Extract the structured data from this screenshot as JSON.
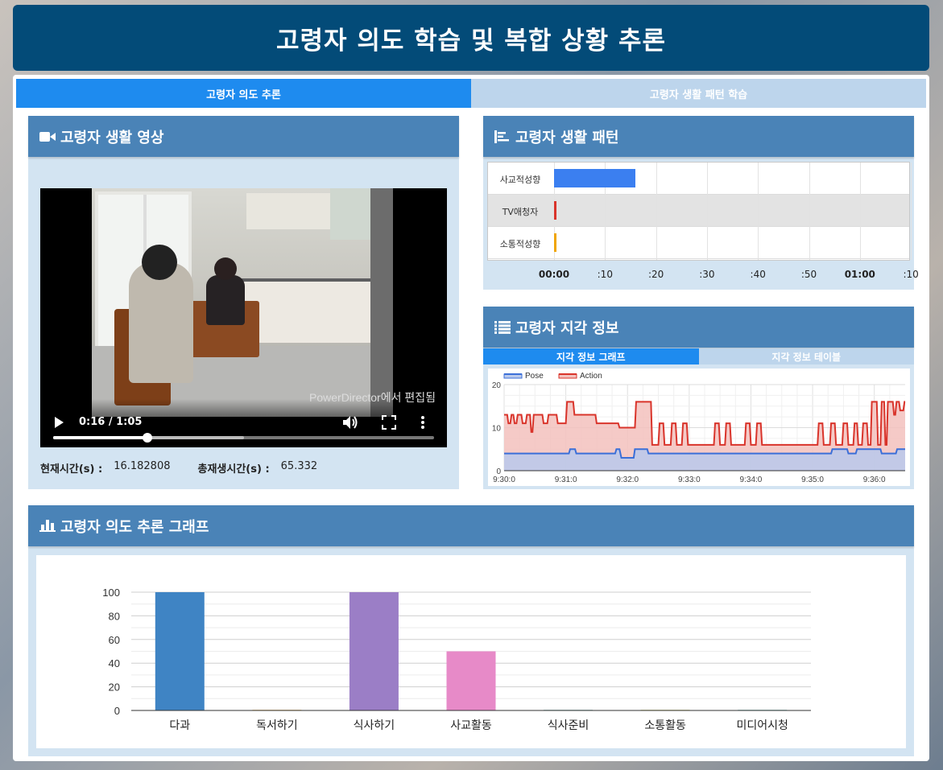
{
  "header": {
    "title": "고령자 의도 학습 및 복합 상황 추론"
  },
  "tabs": [
    {
      "label": "고령자 의도 추론",
      "active": true
    },
    {
      "label": "고령자 생활 패턴 학습",
      "active": false
    }
  ],
  "video_panel": {
    "title": "고령자 생활 영상",
    "icon": "video-camera-icon",
    "player": {
      "time_display": "0:16 / 1:05",
      "watermark": "PowerDirector에서 편집됨",
      "progress_fraction": 0.248,
      "buffered_fraction": 0.5
    },
    "current_time_label": "현재시간(s) :",
    "current_time_value": "16.182808",
    "total_time_label": "총재생시간(s) :",
    "total_time_value": "65.332"
  },
  "pattern_panel": {
    "title": "고령자 생활 패턴",
    "icon": "timeline-icon",
    "rows": [
      {
        "label": "사교적성향",
        "start": 0,
        "end": 16,
        "color": "#3b7ff0"
      },
      {
        "label": "TV애청자",
        "start": 0,
        "end": 0.4,
        "color": "#d9342b"
      },
      {
        "label": "소통적성향",
        "start": 0,
        "end": 0.4,
        "color": "#f0a500"
      }
    ],
    "axis_ticks": [
      {
        "label": "00:00",
        "value": 0,
        "bold": true
      },
      {
        "label": ":10",
        "value": 10,
        "bold": false
      },
      {
        "label": ":20",
        "value": 20,
        "bold": false
      },
      {
        "label": ":30",
        "value": 30,
        "bold": false
      },
      {
        "label": ":40",
        "value": 40,
        "bold": false
      },
      {
        "label": ":50",
        "value": 50,
        "bold": false
      },
      {
        "label": "01:00",
        "value": 60,
        "bold": true
      },
      {
        "label": ":10",
        "value": 70,
        "bold": false
      }
    ]
  },
  "perception_panel": {
    "title": "고령자 지각 정보",
    "icon": "list-icon",
    "subtabs": [
      {
        "label": "지각 정보 그래프",
        "active": true
      },
      {
        "label": "지각 정보 테이블",
        "active": false
      }
    ]
  },
  "intent_panel": {
    "title": "고령자 의도 추론 그래프",
    "icon": "bar-chart-icon"
  },
  "chart_data": [
    {
      "type": "area",
      "x_labels": [
        "9:30:0",
        "9:31:0",
        "9:32:0",
        "9:33:0",
        "9:34:0",
        "9:35:0",
        "9:36:0"
      ],
      "x_range_minutes": [
        0,
        6.5
      ],
      "ylim": [
        0,
        20
      ],
      "y_ticks": [
        0,
        10,
        20
      ],
      "legend_position": "top-left",
      "series": [
        {
          "name": "Pose",
          "color": "#3b6fd8",
          "fill": "#b9c9ec",
          "points": [
            [
              0,
              4
            ],
            [
              1.05,
              4
            ],
            [
              1.07,
              5
            ],
            [
              1.15,
              5
            ],
            [
              1.17,
              4
            ],
            [
              1.8,
              4
            ],
            [
              1.82,
              5
            ],
            [
              1.87,
              5
            ],
            [
              1.9,
              3
            ],
            [
              2.1,
              3
            ],
            [
              2.12,
              5
            ],
            [
              2.32,
              5
            ],
            [
              2.34,
              4
            ],
            [
              5.3,
              4
            ],
            [
              5.32,
              5
            ],
            [
              5.56,
              5
            ],
            [
              5.58,
              4
            ],
            [
              5.7,
              4
            ],
            [
              5.72,
              5
            ],
            [
              6.1,
              5
            ],
            [
              6.12,
              4
            ],
            [
              6.35,
              4
            ],
            [
              6.37,
              5
            ],
            [
              6.5,
              5
            ]
          ]
        },
        {
          "name": "Action",
          "color": "#d9342b",
          "fill": "#f3c1bd",
          "points": [
            [
              0,
              13
            ],
            [
              0.05,
              13
            ],
            [
              0.07,
              11
            ],
            [
              0.1,
              11
            ],
            [
              0.12,
              13
            ],
            [
              0.15,
              13
            ],
            [
              0.17,
              11
            ],
            [
              0.2,
              11
            ],
            [
              0.22,
              13
            ],
            [
              0.28,
              13
            ],
            [
              0.3,
              11
            ],
            [
              0.35,
              11
            ],
            [
              0.37,
              13
            ],
            [
              0.42,
              13
            ],
            [
              0.44,
              9
            ],
            [
              0.46,
              9
            ],
            [
              0.48,
              13
            ],
            [
              0.62,
              13
            ],
            [
              0.64,
              11
            ],
            [
              0.7,
              11
            ],
            [
              0.72,
              13
            ],
            [
              0.85,
              13
            ],
            [
              0.87,
              11
            ],
            [
              1.0,
              11
            ],
            [
              1.02,
              16
            ],
            [
              1.12,
              16
            ],
            [
              1.14,
              13
            ],
            [
              1.48,
              13
            ],
            [
              1.5,
              11
            ],
            [
              1.85,
              11
            ],
            [
              1.87,
              10
            ],
            [
              2.12,
              10
            ],
            [
              2.14,
              16
            ],
            [
              2.38,
              16
            ],
            [
              2.4,
              6
            ],
            [
              2.5,
              6
            ],
            [
              2.52,
              11
            ],
            [
              2.58,
              11
            ],
            [
              2.6,
              6
            ],
            [
              2.7,
              6
            ],
            [
              2.72,
              11
            ],
            [
              2.78,
              11
            ],
            [
              2.8,
              6
            ],
            [
              2.88,
              6
            ],
            [
              2.9,
              11
            ],
            [
              2.96,
              11
            ],
            [
              2.98,
              6
            ],
            [
              3.4,
              6
            ],
            [
              3.42,
              11
            ],
            [
              3.48,
              11
            ],
            [
              3.5,
              6
            ],
            [
              3.58,
              6
            ],
            [
              3.6,
              11
            ],
            [
              3.66,
              11
            ],
            [
              3.68,
              6
            ],
            [
              3.9,
              6
            ],
            [
              3.92,
              11
            ],
            [
              3.98,
              11
            ],
            [
              4.0,
              6
            ],
            [
              4.08,
              6
            ],
            [
              4.1,
              11
            ],
            [
              4.16,
              11
            ],
            [
              4.18,
              6
            ],
            [
              5.08,
              6
            ],
            [
              5.1,
              11
            ],
            [
              5.16,
              11
            ],
            [
              5.18,
              6
            ],
            [
              5.28,
              6
            ],
            [
              5.3,
              11
            ],
            [
              5.36,
              11
            ],
            [
              5.38,
              6
            ],
            [
              5.48,
              6
            ],
            [
              5.5,
              11
            ],
            [
              5.56,
              11
            ],
            [
              5.58,
              6
            ],
            [
              5.66,
              6
            ],
            [
              5.68,
              11
            ],
            [
              5.72,
              11
            ],
            [
              5.74,
              6
            ],
            [
              5.8,
              6
            ],
            [
              5.82,
              11
            ],
            [
              5.88,
              11
            ],
            [
              5.9,
              6
            ],
            [
              5.94,
              6
            ],
            [
              5.96,
              16
            ],
            [
              6.04,
              16
            ],
            [
              6.06,
              6
            ],
            [
              6.1,
              6
            ],
            [
              6.12,
              16
            ],
            [
              6.16,
              16
            ],
            [
              6.18,
              6
            ],
            [
              6.2,
              6
            ],
            [
              6.22,
              16
            ],
            [
              6.3,
              16
            ],
            [
              6.32,
              13
            ],
            [
              6.34,
              13
            ],
            [
              6.36,
              16
            ],
            [
              6.4,
              16
            ],
            [
              6.42,
              14
            ],
            [
              6.47,
              14
            ],
            [
              6.49,
              16
            ],
            [
              6.5,
              16
            ]
          ]
        }
      ]
    },
    {
      "type": "bar",
      "categories": [
        "다과",
        "독서하기",
        "식사하기",
        "사교활동",
        "식사준비",
        "소통활동",
        "미디어시청"
      ],
      "values": [
        100,
        0.5,
        100,
        50,
        0.5,
        0.5,
        0.5
      ],
      "colors": [
        "#3f84c4",
        "#e6a93a",
        "#9b7ec6",
        "#e78ac8",
        "#6aa5a0",
        "#c3c04f",
        "#5ab0a8"
      ],
      "ylim": [
        0,
        100
      ],
      "y_ticks": [
        0,
        20,
        40,
        60,
        80,
        100
      ],
      "grid": true
    }
  ]
}
